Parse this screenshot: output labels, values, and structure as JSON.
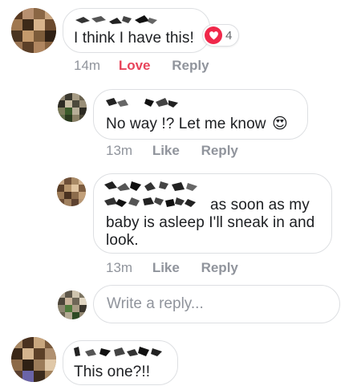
{
  "comments": [
    {
      "text": "I think I have this!",
      "time": "14m",
      "actions": [
        "Love",
        "Reply"
      ],
      "reaction": {
        "icon": "heart-icon",
        "count": "4"
      }
    },
    {
      "text": "No way !? Let me know",
      "emoji": "😍",
      "time": "13m",
      "actions": [
        "Like",
        "Reply"
      ]
    },
    {
      "text_line1_visible": "as soon as my",
      "text_line2": "baby is asleep I'll sneak in and",
      "text_line3": "look.",
      "time": "13m",
      "actions": [
        "Like",
        "Reply"
      ]
    },
    {
      "text": "This one?!!"
    }
  ],
  "reply_box": {
    "placeholder": "Write a reply..."
  },
  "colors": {
    "love": "#e8445b",
    "meta": "#90949c",
    "border": "#dddfe2",
    "heart": "#f0284a"
  }
}
